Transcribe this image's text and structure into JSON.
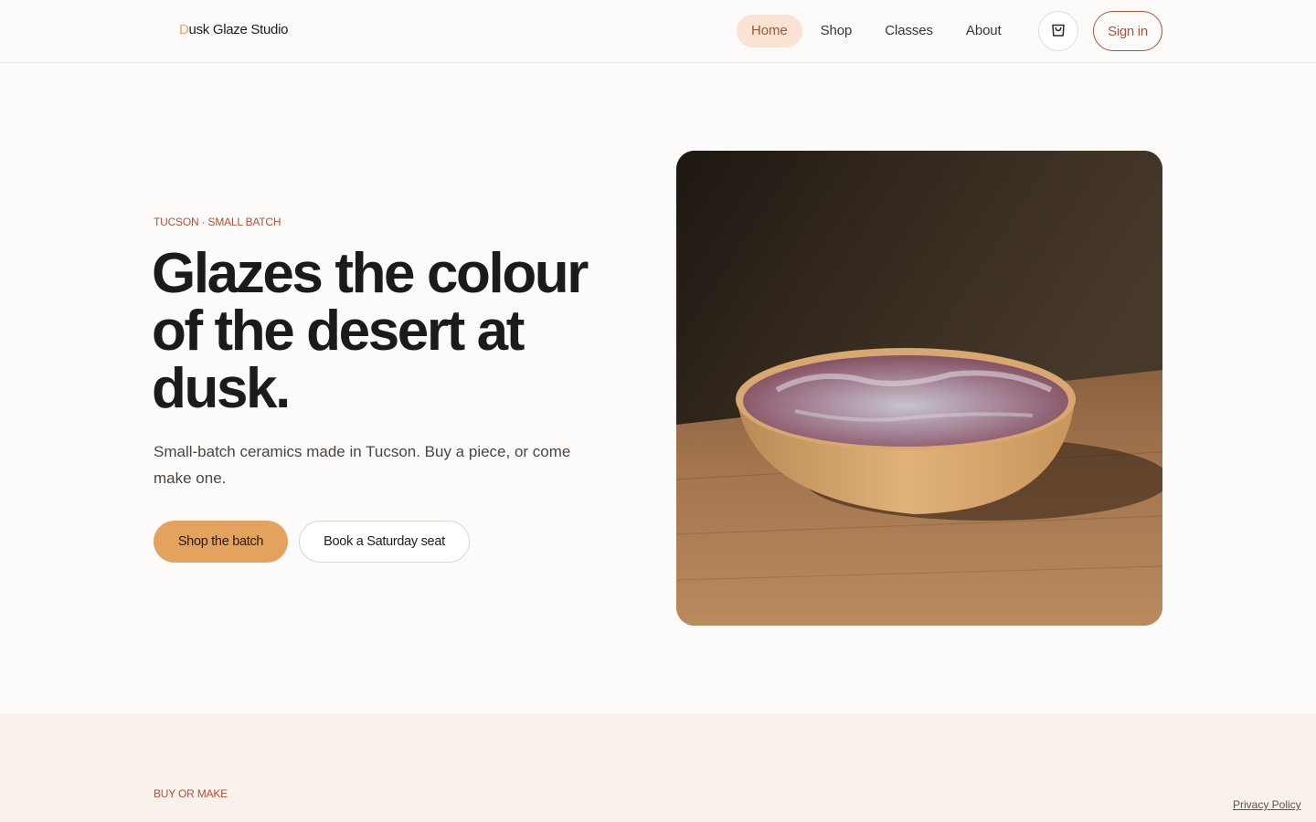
{
  "brand": {
    "first_letter": "D",
    "rest": "usk Glaze Studio"
  },
  "nav": {
    "items": [
      {
        "label": "Home"
      },
      {
        "label": "Shop"
      },
      {
        "label": "Classes"
      },
      {
        "label": "About"
      }
    ],
    "active": "Home",
    "cart_icon": "shopping-bag-icon",
    "signin_label": "Sign in"
  },
  "hero": {
    "eyebrow": "TUCSON · SMALL BATCH",
    "title": "Glazes the colour of the desert at dusk.",
    "subtitle": "Small-batch ceramics made in Tucson. Buy a piece, or come make one.",
    "primary_cta": "Shop the batch",
    "secondary_cta": "Book a Saturday seat"
  },
  "section": {
    "eyebrow": "BUY OR MAKE"
  },
  "footer": {
    "privacy_label": "Privacy Policy"
  },
  "colors": {
    "accent": "#e3a35f",
    "accent_dark": "#a7553a",
    "nav_active_bg": "#fbe3d3",
    "section_bg": "#fbf1ec"
  }
}
